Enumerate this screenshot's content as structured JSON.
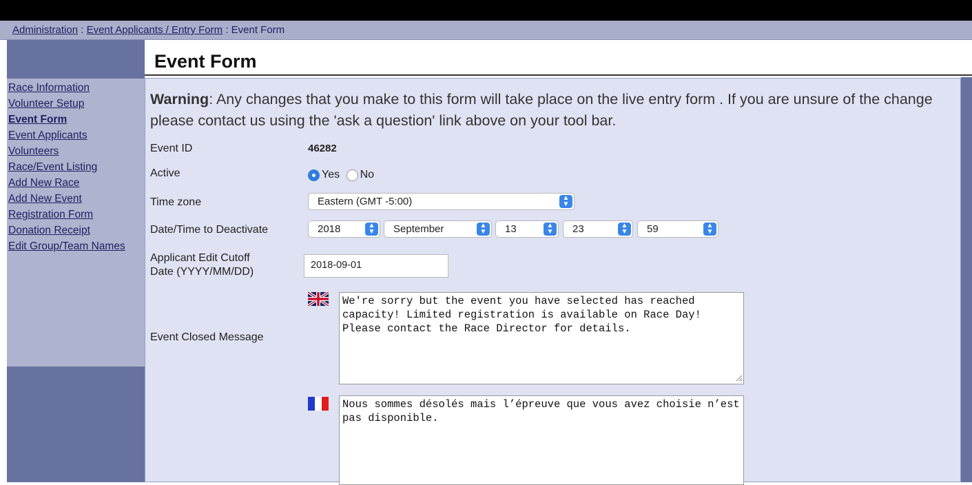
{
  "breadcrumb": {
    "items": [
      "Administration",
      "Event Applicants / Entry Form",
      "Event Form"
    ],
    "separator": ":"
  },
  "sidebar": {
    "items": [
      {
        "label": "Race Information"
      },
      {
        "label": "Volunteer Setup"
      },
      {
        "label": "Event Form",
        "current": true
      },
      {
        "label": "Event Applicants"
      },
      {
        "label": "Volunteers"
      },
      {
        "label": "Race/Event Listing"
      },
      {
        "label": "Add New Race"
      },
      {
        "label": "Add New Event"
      },
      {
        "label": "Registration Form"
      },
      {
        "label": "Donation Receipt"
      },
      {
        "label": "Edit Group/Team Names"
      }
    ]
  },
  "page": {
    "title": "Event Form"
  },
  "warning": {
    "prefix": "Warning",
    "text": ": Any changes that you make to this form will take place on the live entry form . If you are unsure of the change please contact us using the 'ask a question' link above on your tool bar."
  },
  "form": {
    "event_id_label": "Event ID",
    "event_id_value": "46282",
    "active_label": "Active",
    "active_yes": "Yes",
    "active_no": "No",
    "active_selected": "Yes",
    "timezone_label": "Time zone",
    "timezone_value": "Eastern (GMT -5:00)",
    "deactivate_label": "Date/Time to Deactivate",
    "deactivate_year": "2018",
    "deactivate_month": "September",
    "deactivate_day": "13",
    "deactivate_hour": "23",
    "deactivate_minute": "59",
    "cutoff_label_line1": "Applicant Edit Cutoff",
    "cutoff_label_line2": "Date (YYYY/MM/DD)",
    "cutoff_value": "2018-09-01",
    "closed_message_label": "Event Closed Message",
    "closed_message_en": "We're sorry but the event you have selected has reached capacity! Limited registration is available on Race Day! Please contact the Race Director for details.",
    "closed_message_fr": "Nous sommes désolés mais l’épreuve que vous avez choisie n’est pas disponible."
  },
  "colors": {
    "sidebar_bg": "#6872a0",
    "sidebar_links_bg": "#aeb3cf",
    "panel_bg": "#dfe2f2",
    "select_arrow": "#3a86e8"
  },
  "icons": {
    "en_flag": "uk-flag-icon",
    "fr_flag": "france-flag-icon",
    "select_arrow": "chevron-updown-icon"
  }
}
